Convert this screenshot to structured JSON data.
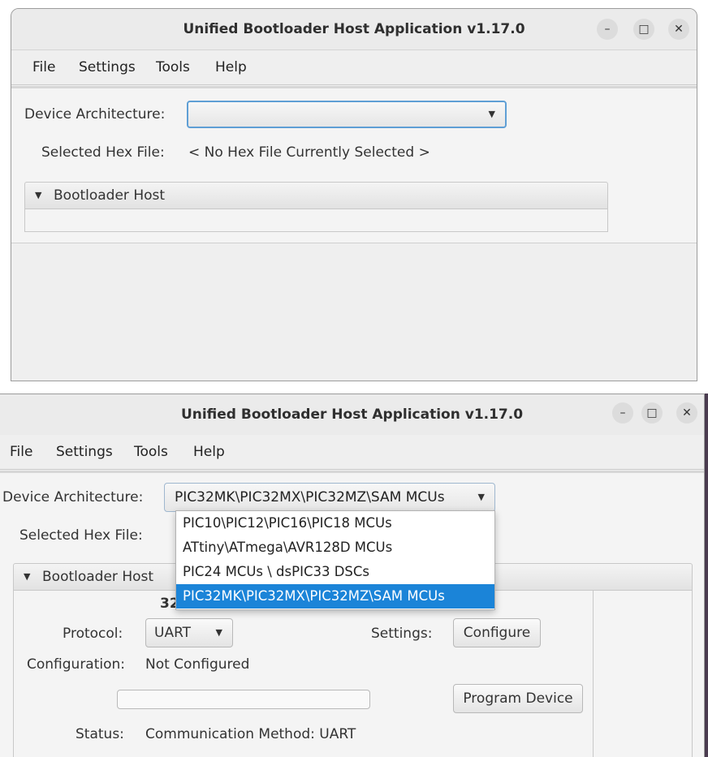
{
  "top": {
    "window_title": "Unified Bootloader Host Application v1.17.0",
    "window_controls": {
      "minimize": "–",
      "maximize": "□",
      "close": "✕"
    },
    "menu": [
      "File",
      "Settings",
      "Tools",
      "Help"
    ],
    "device_architecture_label": "Device Architecture:",
    "device_architecture_value": "",
    "hex_file_label": "Selected Hex File:",
    "hex_file_value": "< No Hex File Currently Selected >",
    "panel_title": "Bootloader Host",
    "panel_icon": "triangle-down-icon"
  },
  "bottom": {
    "window_title": "Unified Bootloader Host Application v1.17.0",
    "window_controls": {
      "minimize": "–",
      "maximize": "□",
      "close": "✕"
    },
    "menu": [
      "File",
      "Settings",
      "Tools",
      "Help"
    ],
    "device_architecture_label": "Device Architecture:",
    "device_architecture_value": "PIC32MK\\PIC32MX\\PIC32MZ\\SAM MCUs",
    "dropdown_options": [
      "PIC10\\PIC12\\PIC16\\PIC18 MCUs",
      "ATtiny\\ATmega\\AVR128D MCUs",
      "PIC24 MCUs \\ dsPIC33 DSCs",
      "PIC32MK\\PIC32MX\\PIC32MZ\\SAM MCUs"
    ],
    "selected_option_index": 3,
    "hex_file_label": "Selected Hex File:",
    "panel_title": "Bootloader Host",
    "partial_heading": "32",
    "protocol_label": "Protocol:",
    "protocol_value": "UART",
    "settings_label": "Settings:",
    "configure_button": "Configure",
    "configuration_label": "Configuration:",
    "configuration_value": "Not Configured",
    "program_device_button": "Program Device",
    "progress": 0,
    "status_label": "Status:",
    "status_value": "Communication Method: UART"
  },
  "colors": {
    "selection": "#1b84d8",
    "focus_border": "#5f9fd5"
  }
}
